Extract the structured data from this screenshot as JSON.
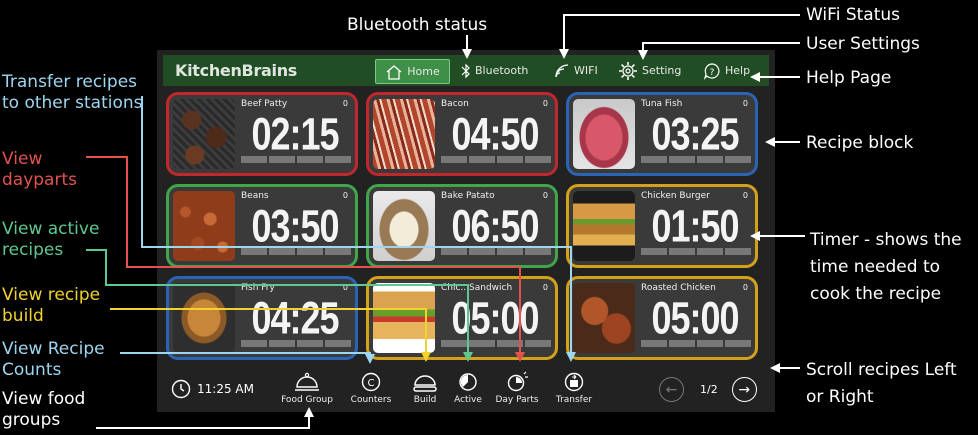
{
  "annotations": {
    "bluetooth": "Bluetooth status",
    "wifi": "WiFi Status",
    "settings": "User Settings",
    "help": "Help Page",
    "transfer": "Transfer recipes\nto other stations",
    "dayparts": "View\ndayparts",
    "active": "View active\nrecipes",
    "build": "View recipe\nbuild",
    "counts": "View Recipe\nCounts",
    "groups": "View food\ngroups",
    "recipe_block": "Recipe block",
    "timer": "Timer - shows the\ntime needed to\ncook the recipe",
    "scroll": "Scroll recipes Left\nor Right"
  },
  "app": {
    "brand": "KitchenBrains",
    "nav": {
      "home": "Home",
      "bluetooth": "Bluetooth",
      "wifi": "WIFI",
      "setting": "Setting",
      "help": "Help"
    }
  },
  "colors": {
    "red": "#c0282b",
    "green": "#3fa64a",
    "blue": "#2b64b6",
    "yellow": "#d4a11a"
  },
  "recipes": [
    {
      "name": "Beef Patty",
      "count": "0",
      "time": "02:15",
      "color": "red",
      "photo": "burger-patties"
    },
    {
      "name": "Bacon",
      "count": "0",
      "time": "04:50",
      "color": "red",
      "photo": "bacon"
    },
    {
      "name": "Tuna Fish",
      "count": "0",
      "time": "03:25",
      "color": "blue",
      "photo": "tuna"
    },
    {
      "name": "Beans",
      "count": "0",
      "time": "03:50",
      "color": "green",
      "photo": "beans"
    },
    {
      "name": "Bake Patato",
      "count": "0",
      "time": "06:50",
      "color": "green",
      "photo": "baked-potato"
    },
    {
      "name": "Chicken Burger",
      "count": "0",
      "time": "01:50",
      "color": "yellow",
      "photo": "chicken-burger"
    },
    {
      "name": "Fish Fry",
      "count": "0",
      "time": "04:25",
      "color": "blue",
      "photo": "fish-fry"
    },
    {
      "name": "Chic.. Sandwich",
      "count": "0",
      "time": "05:00",
      "color": "yellow",
      "photo": "sandwich"
    },
    {
      "name": "Roasted Chicken",
      "count": "0",
      "time": "05:00",
      "color": "yellow",
      "photo": "roasted-chicken"
    }
  ],
  "bottom": {
    "time": "11:25 AM",
    "toolbar": {
      "food_group": "Food Group",
      "counters": "Counters",
      "build": "Build",
      "active": "Active",
      "day_parts": "Day Parts",
      "transfer": "Transfer"
    },
    "page": "1/2"
  }
}
